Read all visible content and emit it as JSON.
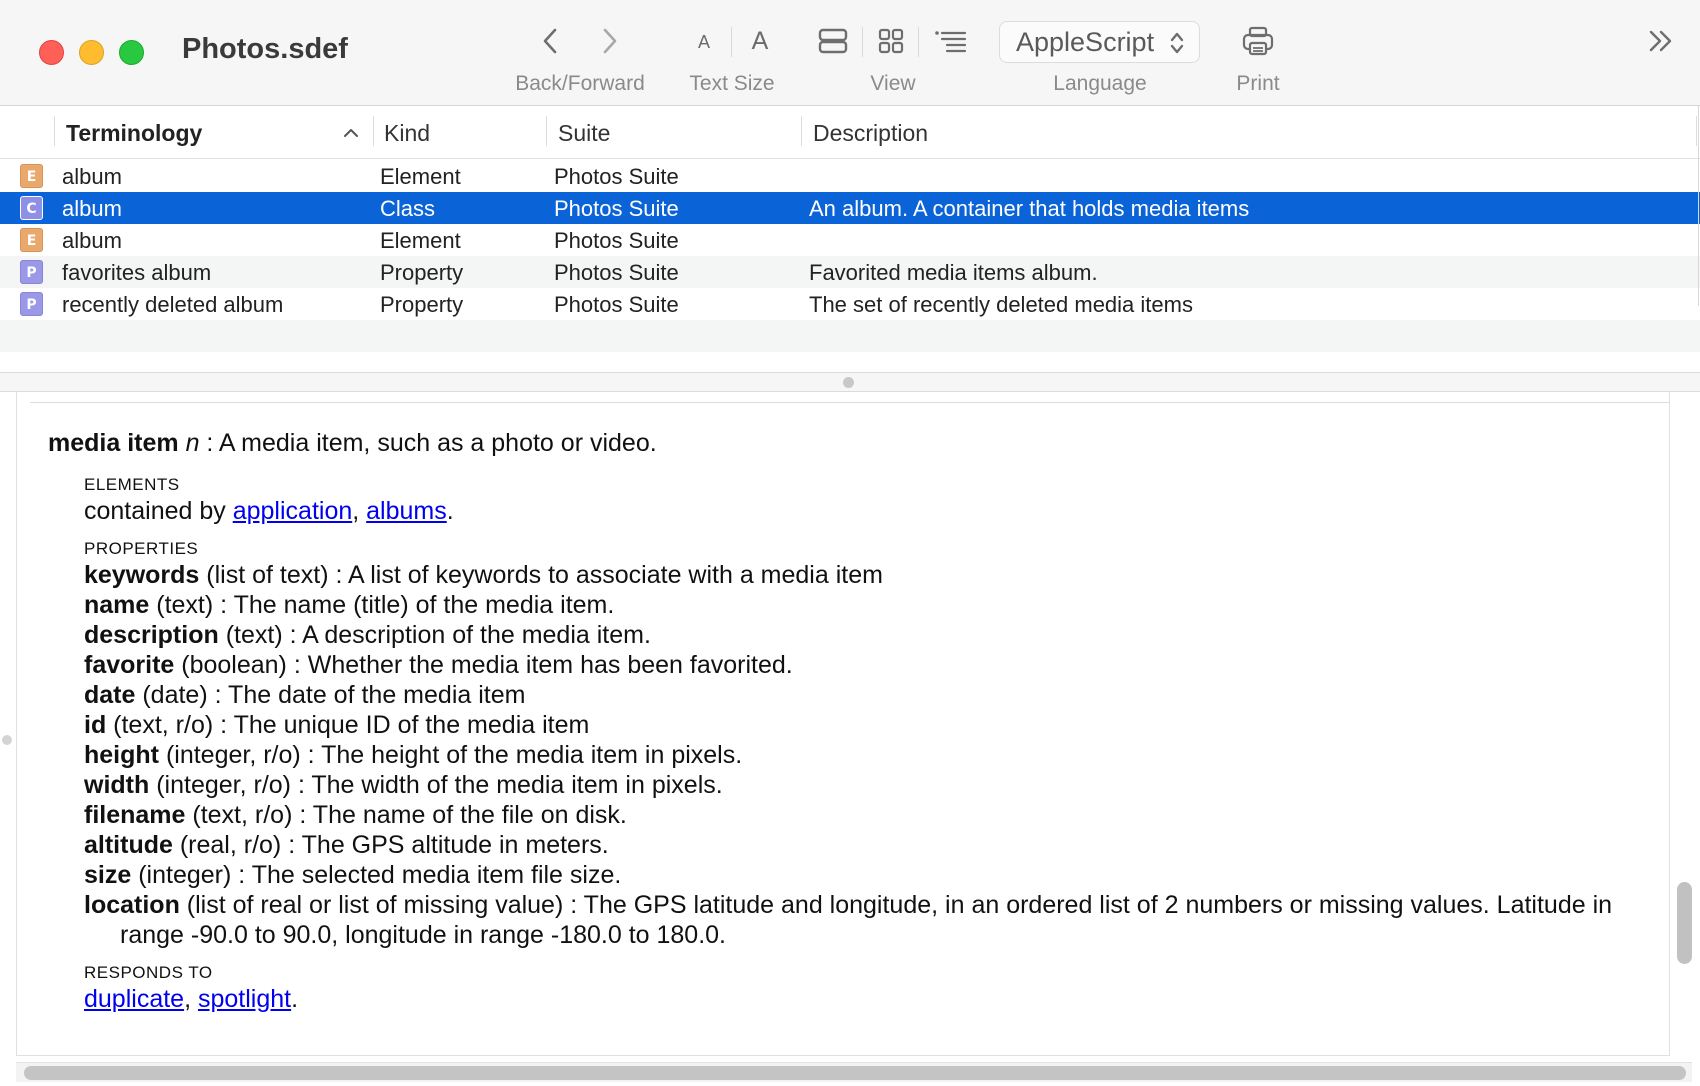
{
  "window": {
    "title": "Photos.sdef"
  },
  "toolbar": {
    "back_forward_label": "Back/Forward",
    "text_size_label": "Text Size",
    "view_label": "View",
    "language_label": "Language",
    "language_value": "AppleScript",
    "print_label": "Print",
    "small_a": "A",
    "large_a": "A",
    "icons": [
      "chevron-left-icon",
      "chevron-right-icon",
      "text-smaller-icon",
      "text-larger-icon",
      "view-split-icon",
      "view-grid-icon",
      "view-list-icon",
      "printer-icon",
      "overflow-chevrons-icon"
    ]
  },
  "table": {
    "columns": [
      "Terminology",
      "Kind",
      "Suite",
      "Description"
    ],
    "sorted_column": "Terminology",
    "rows": [
      {
        "badge": "E",
        "term": "album",
        "kind": "Element",
        "suite": "Photos Suite",
        "description": ""
      },
      {
        "badge": "C",
        "term": "album",
        "kind": "Class",
        "suite": "Photos Suite",
        "description": "An album. A container that holds media items"
      },
      {
        "badge": "E",
        "term": "album",
        "kind": "Element",
        "suite": "Photos Suite",
        "description": ""
      },
      {
        "badge": "P",
        "term": "favorites album",
        "kind": "Property",
        "suite": "Photos Suite",
        "description": "Favorited media items album."
      },
      {
        "badge": "P",
        "term": "recently deleted album",
        "kind": "Property",
        "suite": "Photos Suite",
        "description": "The set of recently deleted media items"
      }
    ],
    "selected_row": 1
  },
  "detail": {
    "title": "media item",
    "kind": "n",
    "summary": " : A media item, such as a photo or video.",
    "elements_heading": "ELEMENTS",
    "contained_by_text": "contained by ",
    "contained_by_links": [
      "application",
      "albums"
    ],
    "properties_heading": "PROPERTIES",
    "properties": [
      {
        "name": "keywords",
        "type": " (list of text)",
        "desc": " : A list of keywords to associate with a media item"
      },
      {
        "name": "name",
        "type": " (text)",
        "desc": " : The name (title) of the media item."
      },
      {
        "name": "description",
        "type": " (text)",
        "desc": " : A description of the media item."
      },
      {
        "name": "favorite",
        "type": " (boolean)",
        "desc": " : Whether the media item has been favorited."
      },
      {
        "name": "date",
        "type": " (date)",
        "desc": " : The date of the media item"
      },
      {
        "name": "id",
        "type": " (text, r/o)",
        "desc": " : The unique ID of the media item"
      },
      {
        "name": "height",
        "type": " (integer, r/o)",
        "desc": " : The height of the media item in pixels."
      },
      {
        "name": "width",
        "type": " (integer, r/o)",
        "desc": " : The width of the media item in pixels."
      },
      {
        "name": "filename",
        "type": " (text, r/o)",
        "desc": " : The name of the file on disk."
      },
      {
        "name": "altitude",
        "type": " (real, r/o)",
        "desc": " : The GPS altitude in meters."
      },
      {
        "name": "size",
        "type": " (integer)",
        "desc": " : The selected media item file size."
      },
      {
        "name": "location",
        "type": " (list of real or list of missing value)",
        "desc": " : The GPS latitude and longitude, in an ordered list of 2 numbers or missing values. Latitude in range -90.0 to 90.0, longitude in range -180.0 to 180.0."
      }
    ],
    "responds_heading": "RESPONDS TO",
    "responds_links": [
      "duplicate",
      "spotlight"
    ]
  },
  "colors": {
    "selection": "#0b63d8",
    "link": "#0000ee",
    "badge_element": "#e9a86c",
    "badge_class": "#8f8fe8",
    "badge_property": "#9c98e8",
    "close": "#fe5f57",
    "minimize": "#febc2e",
    "zoom": "#28c840"
  }
}
